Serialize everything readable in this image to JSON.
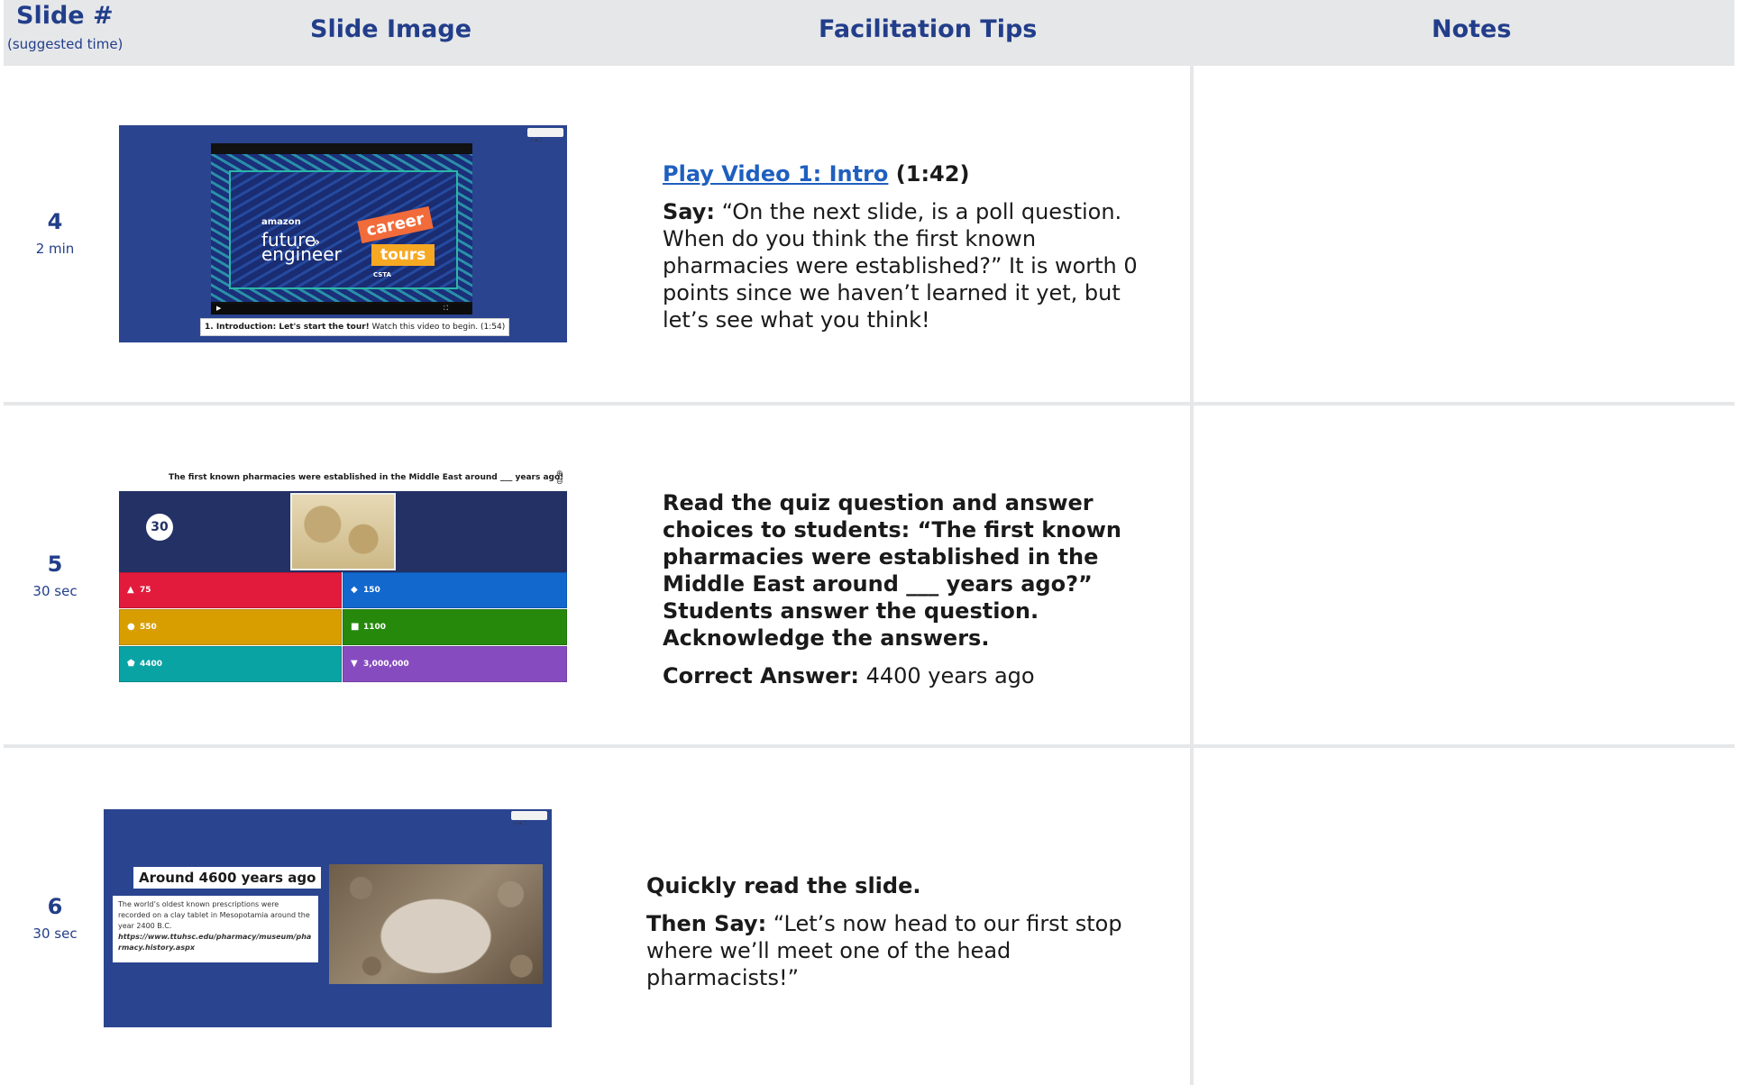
{
  "header": {
    "slide_num_label": "Slide #",
    "slide_num_sub": "(suggested time)",
    "slide_image_label": "Slide Image",
    "tips_label": "Facilitation Tips",
    "notes_label": "Notes"
  },
  "rows": [
    {
      "num": "4",
      "time": "2 min",
      "thumb": {
        "amazon": "amazon",
        "future": "future",
        "engineer": "engineer",
        "career": "career",
        "tours": "tours",
        "logo": "CSTA",
        "caption_bold": "1. Introduction: Let's start the tour!",
        "caption_rest": " Watch this video to begin. (1:54)"
      },
      "tips": {
        "link": "Play Video 1: Intro",
        "duration": " (1:42)",
        "say_label": "Say:",
        "say_text": " “On the next slide, is a poll question. When do you think the first known pharmacies were established?” It is worth 0 points since we haven’t learned it yet, but let’s see what you think!"
      }
    },
    {
      "num": "5",
      "time": "30 sec",
      "quiz": {
        "question": "The first known pharmacies were established in the Middle East around ___ years ago!",
        "timer": "30",
        "options": [
          {
            "symbol": "▲",
            "label": "75",
            "color": "#e21b3c"
          },
          {
            "symbol": "◆",
            "label": "150",
            "color": "#1368ce"
          },
          {
            "symbol": "●",
            "label": "550",
            "color": "#d89e00"
          },
          {
            "symbol": "■",
            "label": "1100",
            "color": "#26890c"
          },
          {
            "symbol": "⬟",
            "label": "4400",
            "color": "#0aa3a3"
          },
          {
            "symbol": "▼",
            "label": "3,000,000",
            "color": "#864cbf"
          }
        ]
      },
      "tips": {
        "instruction": "Read the quiz question and answer choices to students: “The first known pharmacies were established in the Middle East around ___ years ago?” Students answer the question. Acknowledge the answers.",
        "answer_label": "Correct Answer:",
        "answer_text": " 4400 years ago"
      }
    },
    {
      "num": "6",
      "time": "30 sec",
      "slide": {
        "title": "Around 4600 years ago",
        "body": "The world’s oldest known prescriptions were recorded on a clay tablet in Mesopotamia around the year 2400 B.C.",
        "link": "https://www.ttuhsc.edu/pharmacy/museum/pharmacy.history.aspx"
      },
      "tips": {
        "instruction": "Quickly read the slide.",
        "then_label": "Then Say:",
        "then_text": " “Let’s now head to our first stop where we’ll meet one of the head pharmacists!”"
      }
    }
  ]
}
